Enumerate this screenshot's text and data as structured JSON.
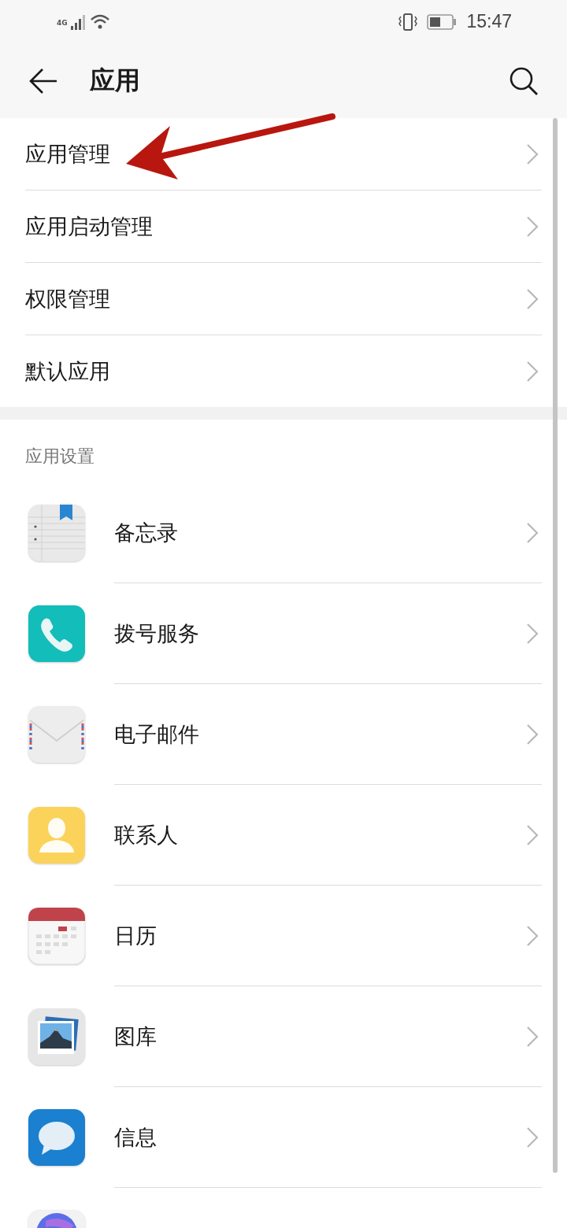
{
  "status_bar": {
    "network": "4G",
    "time": "15:47"
  },
  "header": {
    "title": "应用"
  },
  "menu": [
    {
      "label": "应用管理"
    },
    {
      "label": "应用启动管理"
    },
    {
      "label": "权限管理"
    },
    {
      "label": "默认应用"
    }
  ],
  "app_settings": {
    "title": "应用设置",
    "apps": [
      {
        "label": "备忘录",
        "kind": "notes"
      },
      {
        "label": "拨号服务",
        "kind": "phone"
      },
      {
        "label": "电子邮件",
        "kind": "mail"
      },
      {
        "label": "联系人",
        "kind": "contacts"
      },
      {
        "label": "日历",
        "kind": "calendar"
      },
      {
        "label": "图库",
        "kind": "gallery"
      },
      {
        "label": "信息",
        "kind": "messages"
      },
      {
        "kind": "orb"
      }
    ]
  }
}
